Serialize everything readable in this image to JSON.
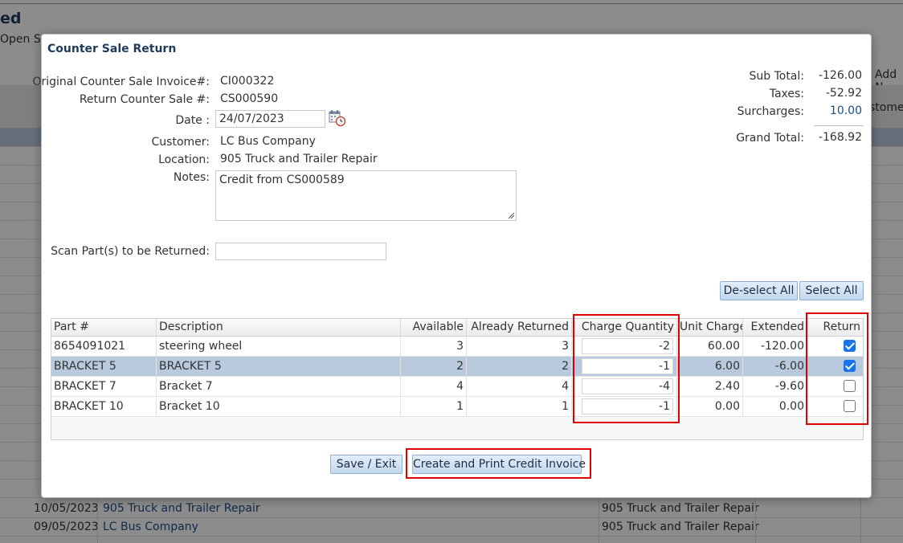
{
  "background": {
    "title": "ed",
    "subtitle": "Open Sal",
    "add_text": "Add N",
    "customer_col": "stome",
    "rows": [
      {
        "date": "10/05/2023",
        "customer": "905 Truck and Trailer Repair",
        "location": "905 Truck and Trailer Repair"
      },
      {
        "date": "09/05/2023",
        "customer": "LC Bus Company",
        "location": "905 Truck and Trailer Repair"
      }
    ]
  },
  "modal": {
    "title": "Counter Sale Return",
    "fields": {
      "original_invoice_label": "Original Counter Sale Invoice#:",
      "original_invoice_value": "CI000322",
      "return_sale_label": "Return Counter Sale #:",
      "return_sale_value": "CS000590",
      "date_label": "Date :",
      "date_value": "24/07/2023",
      "customer_label": "Customer:",
      "customer_value": "LC Bus Company",
      "location_label": "Location:",
      "location_value": "905 Truck and Trailer Repair",
      "notes_label": "Notes:",
      "notes_value": "Credit from CS000589",
      "scan_label": "Scan Part(s) to be Returned:",
      "scan_value": ""
    },
    "totals": {
      "subtotal_label": "Sub Total:",
      "subtotal_value": "-126.00",
      "taxes_label": "Taxes:",
      "taxes_value": "-52.92",
      "surcharges_label": "Surcharges:",
      "surcharges_value": "10.00",
      "grand_total_label": "Grand Total:",
      "grand_total_value": "-168.92"
    },
    "buttons": {
      "deselect_all": "De-select All",
      "select_all": "Select All",
      "save_exit": "Save / Exit",
      "create_print": "Create and Print Credit Invoice"
    },
    "grid": {
      "columns": [
        "Part #",
        "Description",
        "Available",
        "Already Returned",
        "Charge Quantity",
        "Unit Charge",
        "Extended",
        "Return"
      ],
      "rows": [
        {
          "part": "8654091021",
          "description": "steering wheel",
          "available": "3",
          "already_returned": "3",
          "charge_quantity": "-2",
          "unit_charge": "60.00",
          "extended": "-120.00",
          "return": true
        },
        {
          "part": "BRACKET 5",
          "description": "BRACKET 5",
          "available": "2",
          "already_returned": "2",
          "charge_quantity": "-1",
          "unit_charge": "6.00",
          "extended": "-6.00",
          "return": true
        },
        {
          "part": "BRACKET 7",
          "description": "Bracket 7",
          "available": "4",
          "already_returned": "4",
          "charge_quantity": "-4",
          "unit_charge": "2.40",
          "extended": "-9.60",
          "return": false
        },
        {
          "part": "BRACKET 10",
          "description": "Bracket 10",
          "available": "1",
          "already_returned": "1",
          "charge_quantity": "-1",
          "unit_charge": "0.00",
          "extended": "0.00",
          "return": false
        }
      ],
      "selected_row": 1
    }
  },
  "colors": {
    "highlight": "#e00000",
    "title": "#1d3c5c",
    "selected_row": "#b9c9de",
    "link": "#1d4d8a"
  }
}
